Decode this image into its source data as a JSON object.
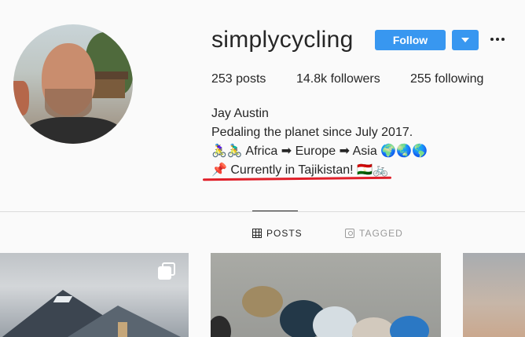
{
  "profile": {
    "username": "simplycycling",
    "follow_label": "Follow",
    "stats": {
      "posts": "253 posts",
      "followers": "14.8k followers",
      "following": "255 following"
    },
    "bio": {
      "name": "Jay Austin",
      "line1": "Pedaling the planet since July 2017.",
      "line2": "🚴‍♀️🚴‍♂️ Africa ➡ Europe ➡ Asia 🌍🌏🌎",
      "line3": "📌 Currently in Tajikistan! 🇹🇯🚲"
    }
  },
  "tabs": {
    "posts": "POSTS",
    "tagged": "TAGGED"
  },
  "colors": {
    "accent": "#3897f0",
    "annotation_underline": "#e0202a"
  },
  "icons": [
    "chevron-down-icon",
    "more-options-icon",
    "grid-icon",
    "tagged-icon",
    "multiple-photos-icon"
  ]
}
